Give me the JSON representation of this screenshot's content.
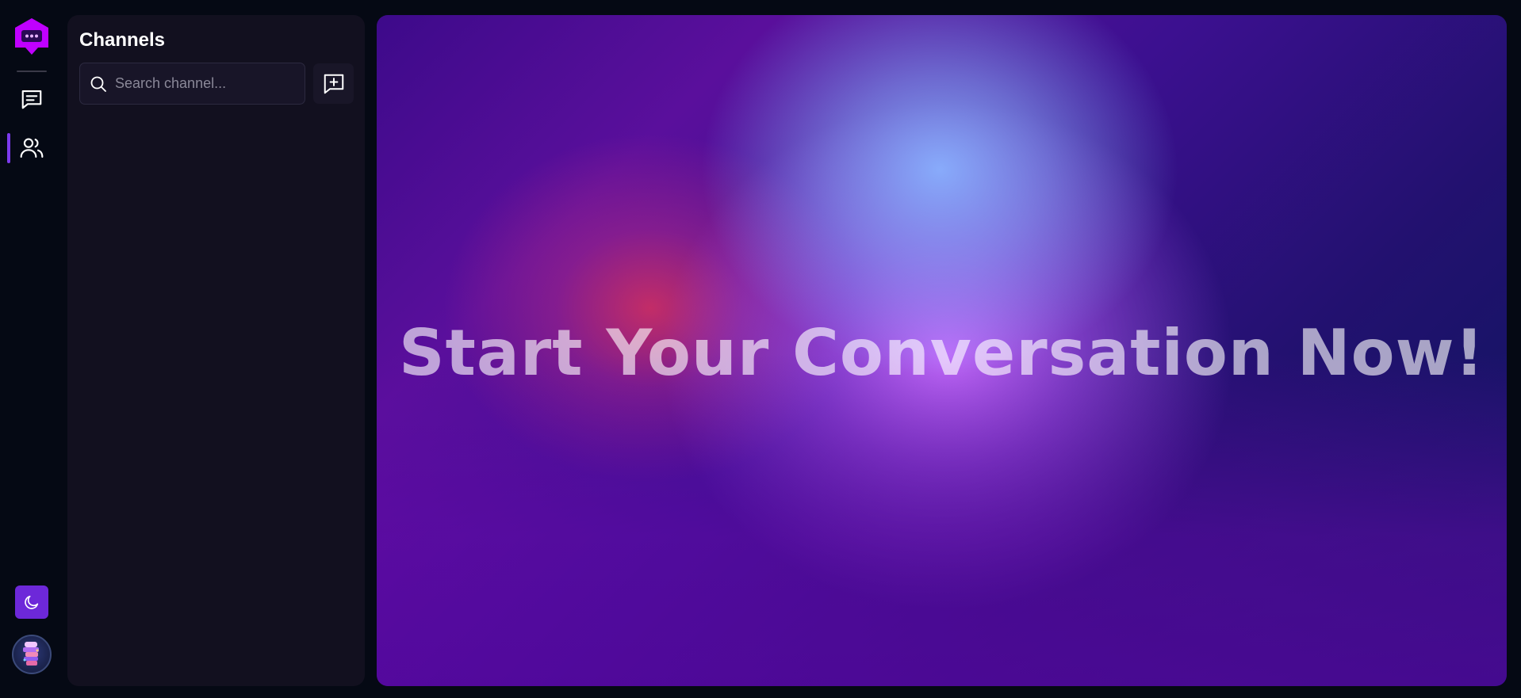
{
  "rail": {
    "logo_icon": "chat-bubble-logo-icon",
    "nav": [
      {
        "name": "chats",
        "icon": "message-lines-icon"
      },
      {
        "name": "people",
        "icon": "users-icon",
        "active": true
      }
    ],
    "theme_icon": "moon-icon",
    "accent": "#7c3aed"
  },
  "channels": {
    "title": "Channels",
    "search_placeholder": "Search channel...",
    "search_value": "",
    "new_channel_icon": "message-plus-icon"
  },
  "hero": {
    "headline": "Start Your Conversation Now!"
  }
}
